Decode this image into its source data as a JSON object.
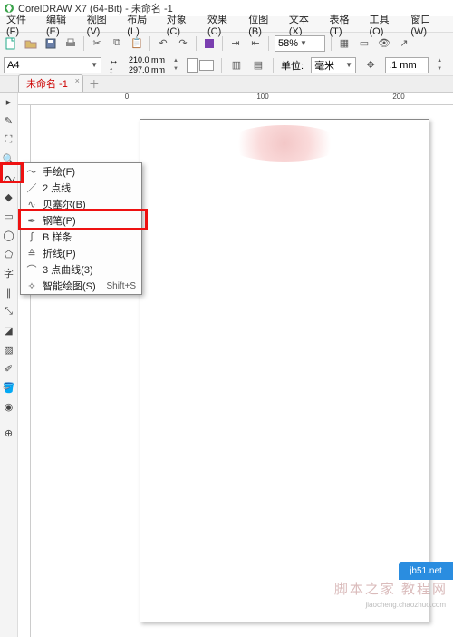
{
  "titlebar": {
    "app": "CorelDRAW X7 (64-Bit)",
    "doc": "未命名 -1"
  },
  "menu": {
    "file": "文件(F)",
    "edit": "编辑(E)",
    "view": "视图(V)",
    "layout": "布局(L)",
    "object": "对象(C)",
    "effects": "效果(C)",
    "bitmap": "位图(B)",
    "text": "文本(X)",
    "table": "表格(T)",
    "tools": "工具(O)",
    "window": "窗口(W)"
  },
  "toolbar": {
    "zoom": "58%"
  },
  "propbar": {
    "pagesize": "A4",
    "width": "210.0 mm",
    "height": "297.0 mm",
    "units_label": "单位:",
    "units": "毫米",
    "nudge": ".1 mm"
  },
  "tab": {
    "name": "未命名 -1"
  },
  "ruler": {
    "t0": "0",
    "t1": "100",
    "t2": "200"
  },
  "flyout": {
    "freehand": "手绘(F)",
    "twopoint": "2 点线",
    "bezier": "贝塞尔(B)",
    "pen": "钢笔(P)",
    "bspline": "B 样条",
    "polyline": "折线(P)",
    "threecurve": "3 点曲线(3)",
    "smart": "智能绘图(S)",
    "smart_sc": "Shift+S"
  },
  "watermark": {
    "main": "脚本之家 教程网",
    "sub": "jiaocheng.chaozhuo.com",
    "badge": "jb51.net"
  }
}
